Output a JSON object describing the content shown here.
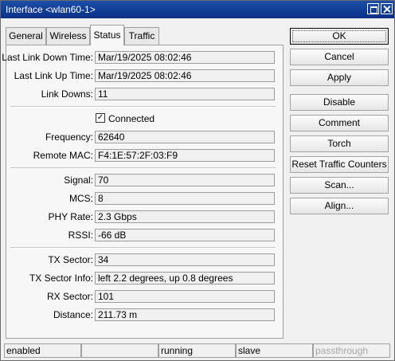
{
  "window": {
    "title": "Interface <wlan60-1>"
  },
  "tabs": [
    {
      "label": "General"
    },
    {
      "label": "Wireless"
    },
    {
      "label": "Status"
    },
    {
      "label": "Traffic"
    }
  ],
  "status_fields": {
    "last_link_down_label": "Last Link Down Time:",
    "last_link_down_value": "Mar/19/2025 08:02:46",
    "last_link_up_label": "Last Link Up Time:",
    "last_link_up_value": "Mar/19/2025 08:02:46",
    "link_downs_label": "Link Downs:",
    "link_downs_value": "11",
    "connected_label": "Connected",
    "connected_checked": true,
    "frequency_label": "Frequency:",
    "frequency_value": "62640",
    "remote_mac_label": "Remote MAC:",
    "remote_mac_value": "F4:1E:57:2F:03:F9",
    "signal_label": "Signal:",
    "signal_value": "70",
    "mcs_label": "MCS:",
    "mcs_value": "8",
    "phy_rate_label": "PHY Rate:",
    "phy_rate_value": "2.3 Gbps",
    "rssi_label": "RSSI:",
    "rssi_value": "-66 dB",
    "tx_sector_label": "TX Sector:",
    "tx_sector_value": "34",
    "tx_sector_info_label": "TX Sector Info:",
    "tx_sector_info_value": "left 2.2 degrees, up 0.8 degrees",
    "rx_sector_label": "RX Sector:",
    "rx_sector_value": "101",
    "distance_label": "Distance:",
    "distance_value": "211.73 m"
  },
  "buttons": {
    "ok": "OK",
    "cancel": "Cancel",
    "apply": "Apply",
    "disable": "Disable",
    "comment": "Comment",
    "torch": "Torch",
    "reset_traffic_counters": "Reset Traffic Counters",
    "scan": "Scan...",
    "align": "Align..."
  },
  "statusbar": {
    "state": "enabled",
    "blank": "",
    "run": "running",
    "mode": "slave",
    "passthrough": "passthrough"
  }
}
